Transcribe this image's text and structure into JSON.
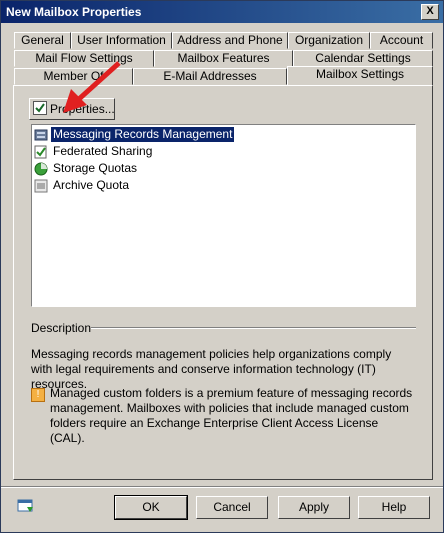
{
  "window": {
    "title": "New Mailbox Properties",
    "close_label": "X"
  },
  "tabs": {
    "row1": [
      "General",
      "User Information",
      "Address and Phone",
      "Organization",
      "Account"
    ],
    "row2": [
      "Mail Flow Settings",
      "Mailbox Features",
      "Calendar Settings"
    ],
    "row3": [
      "Member Of",
      "E-Mail Addresses",
      "Mailbox Settings"
    ]
  },
  "toolbar": {
    "properties_label": "Properties..."
  },
  "settings_list": [
    {
      "label": "Messaging Records Management",
      "icon": "records-icon",
      "selected": true
    },
    {
      "label": "Federated Sharing",
      "icon": "federated-icon",
      "selected": false
    },
    {
      "label": "Storage Quotas",
      "icon": "quota-icon",
      "selected": false
    },
    {
      "label": "Archive Quota",
      "icon": "archive-icon",
      "selected": false
    }
  ],
  "description": {
    "title": "Description",
    "text": "Messaging records management policies help organizations comply with legal requirements and conserve information technology (IT) resources.",
    "note": "Managed custom folders is a premium feature of messaging records management. Mailboxes with policies that include managed custom folders require an Exchange Enterprise Client Access License (CAL)."
  },
  "buttons": {
    "ok": "OK",
    "cancel": "Cancel",
    "apply": "Apply",
    "help": "Help"
  },
  "colors": {
    "selection": "#0a246a",
    "titlebar": "#0a246a",
    "arrow": "#e02020"
  }
}
